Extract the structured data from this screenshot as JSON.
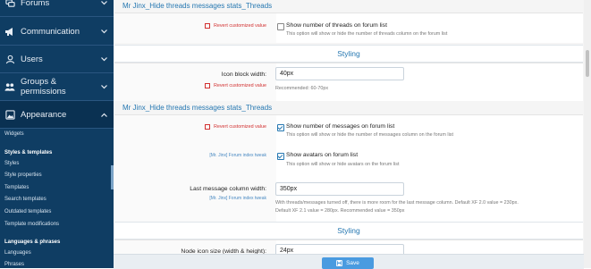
{
  "sidebar": {
    "main": [
      {
        "label": "Forums",
        "icon": "forums-icon"
      },
      {
        "label": "Communication",
        "icon": "megaphone-icon"
      },
      {
        "label": "Users",
        "icon": "user-icon"
      },
      {
        "label": "Groups & permissions",
        "icon": "users-icon"
      },
      {
        "label": "Appearance",
        "icon": "image-icon"
      }
    ],
    "sub": {
      "widgets": "Widgets",
      "styles_heading": "Styles & templates",
      "styles": "Styles",
      "style_properties": "Style properties",
      "templates": "Templates",
      "search_templates": "Search templates",
      "outdated_templates": "Outdated templates",
      "template_modifications": "Template modifications",
      "lang_heading": "Languages & phrases",
      "languages": "Languages",
      "phrases": "Phrases"
    }
  },
  "content": {
    "section1_title": "Mr Jinx_Hide threads messages stats_Threads",
    "revert_label": "Revert customized value",
    "threads_option": "Show number of threads on forum list",
    "threads_hint": "This option will show or hide the number of threads column on the forum list",
    "styling_label": "Styling",
    "icon_block_label": "Icon block width:",
    "icon_block_value": "40px",
    "icon_block_hint": "Recommended: 60-70px",
    "section2_title": "Mr Jinx_Hide threads messages stats_Threads",
    "messages_option": "Show number of messages on forum list",
    "messages_hint": "This option will show or hide the number of messages column on the forum list",
    "addon_tag": "[Mr. Jinx] Forum index tweak",
    "avatars_option": "Show avatars on forum list",
    "avatars_hint": "This option will show or hide avatars on the forum list",
    "last_msg_label": "Last message column width:",
    "last_msg_value": "350px",
    "last_msg_hint1": "With threads/messages turned off, there is more room for the last message column. Default XF 2.0 value = 230px.",
    "last_msg_hint2": "Default XF 2.1 value = 280px. Recommended value = 350px",
    "styling2_label": "Styling",
    "node_icon_label": "Node icon size (width & height):",
    "node_icon_value": "24px"
  },
  "footer": {
    "save_label": "Save",
    "save_icon": "save-icon"
  },
  "colors": {
    "sidebar": "#0f3d63",
    "accent": "#2577b1",
    "revert": "#d23030",
    "save": "#4a9be0"
  }
}
